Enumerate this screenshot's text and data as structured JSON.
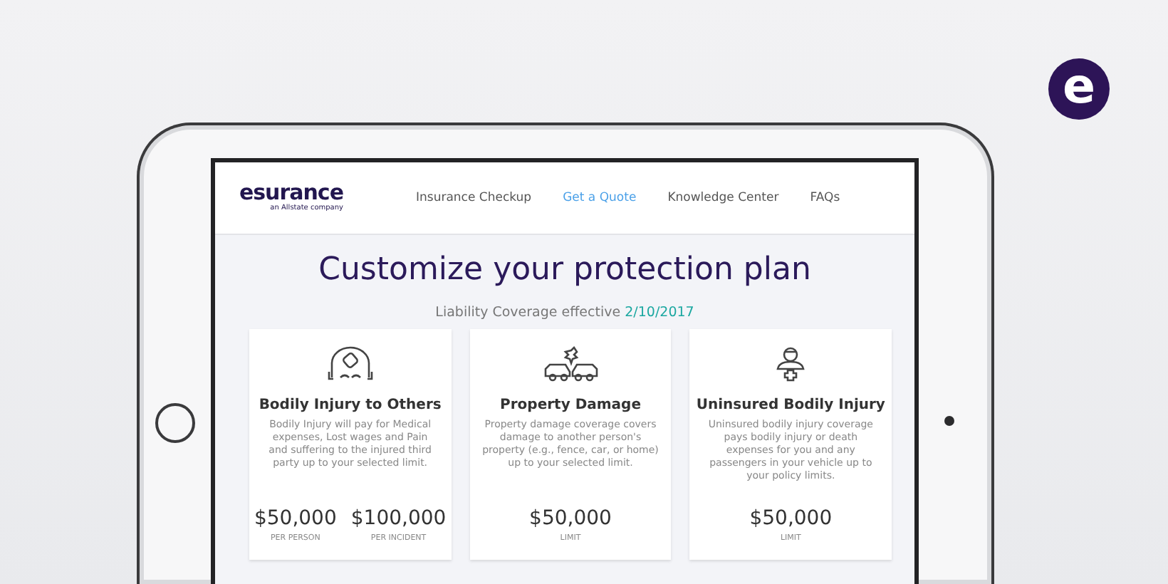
{
  "badge": {
    "letter": "e"
  },
  "nav": {
    "logo": "esurance",
    "tagline": "an Allstate company",
    "links": [
      {
        "label": "Insurance Checkup",
        "selected": false
      },
      {
        "label": "Get a Quote",
        "selected": true
      },
      {
        "label": "Knowledge Center",
        "selected": false
      },
      {
        "label": "FAQs",
        "selected": false
      }
    ]
  },
  "heading": "Customize your protection plan",
  "coverage": {
    "label": "Liability Coverage effective",
    "date": "2/10/2017"
  },
  "cards": [
    {
      "kind": "injury",
      "title": "Bodily Injury to Others",
      "description": "Bodily Injury will pay for Medical expenses, Lost wages and Pain and suffering to the injured third party up to your selected limit.",
      "amounts": [
        {
          "value": "$50,000",
          "label": "PER PERSON"
        },
        {
          "value": "$100,000",
          "label": "PER INCIDENT"
        }
      ]
    },
    {
      "kind": "property",
      "title": "Property Damage",
      "description": "Property damage coverage covers damage to another person's property (e.g., fence, car, or home) up to your selected limit.",
      "amounts": [
        {
          "value": "$50,000",
          "label": "LIMIT"
        }
      ]
    },
    {
      "kind": "uninsured",
      "title": "Uninsured Bodily Injury",
      "description": "Uninsured bodily injury coverage pays bodily injury or death expenses for you and any passengers in your vehicle up to your policy limits.",
      "amounts": [
        {
          "value": "$50,000",
          "label": "LIMIT"
        }
      ]
    }
  ]
}
